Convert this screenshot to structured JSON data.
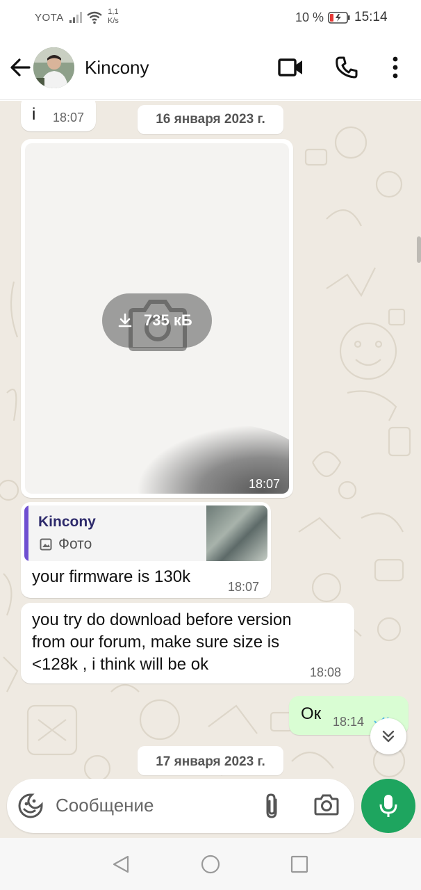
{
  "status_bar": {
    "carrier": "YOTA",
    "speed_value": "1,1",
    "speed_unit": "K/s",
    "battery_percent": "10 %",
    "time": "15:14"
  },
  "header": {
    "contact_name": "Kincony",
    "icons": [
      "back-arrow-icon",
      "video-call-icon",
      "phone-icon",
      "more-vert-icon"
    ]
  },
  "messages": [
    {
      "direction": "in",
      "text": "i",
      "time": "18:07"
    },
    {
      "type": "date",
      "text": "16 января 2023 г."
    },
    {
      "direction": "in",
      "type": "photo",
      "size": "735 кБ",
      "time": "18:07"
    },
    {
      "direction": "in",
      "quote": {
        "author": "Kincony",
        "text": "Фото"
      },
      "text": "your firmware is 130k",
      "time": "18:07"
    },
    {
      "direction": "in",
      "lines": [
        "you try do download before version",
        "from our forum, make sure size is",
        "<128k , i think will be ok"
      ],
      "time": "18:08"
    },
    {
      "direction": "out",
      "text": "Ок",
      "time": "18:14",
      "status": "read"
    },
    {
      "type": "date",
      "text": "17 января 2023 г."
    }
  ],
  "composer": {
    "placeholder": "Сообщение"
  },
  "colors": {
    "chat_background": "#efeae2",
    "outgoing_bubble": "#d9fdd3",
    "accent_green": "#1ea55f",
    "read_ticks": "#53bdeb",
    "quote_bar": "#6f4fd1"
  }
}
